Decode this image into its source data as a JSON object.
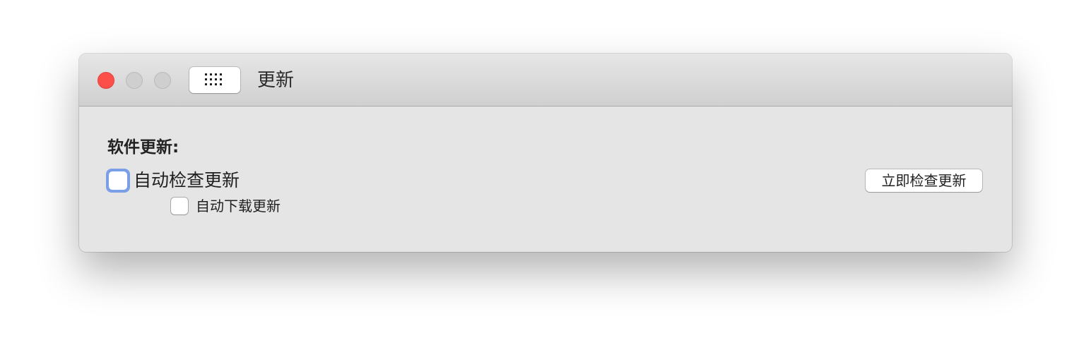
{
  "window": {
    "title": "更新",
    "traffic_lights": {
      "close_color": "#fd4f4a",
      "minimize_color": "#cfcfcf",
      "zoom_color": "#cfcfcf"
    },
    "toolbar_icon": "show-all-grid-icon"
  },
  "software_update": {
    "section_label": "软件更新:",
    "auto_check_label": "自动检查更新",
    "auto_check_checked": false,
    "auto_check_focused": true,
    "auto_download_label": "自动下载更新",
    "auto_download_checked": false,
    "check_now_label": "立即检查更新"
  },
  "colors": {
    "focus_ring": "#7a9fe6",
    "window_background": "#e5e5e5"
  }
}
